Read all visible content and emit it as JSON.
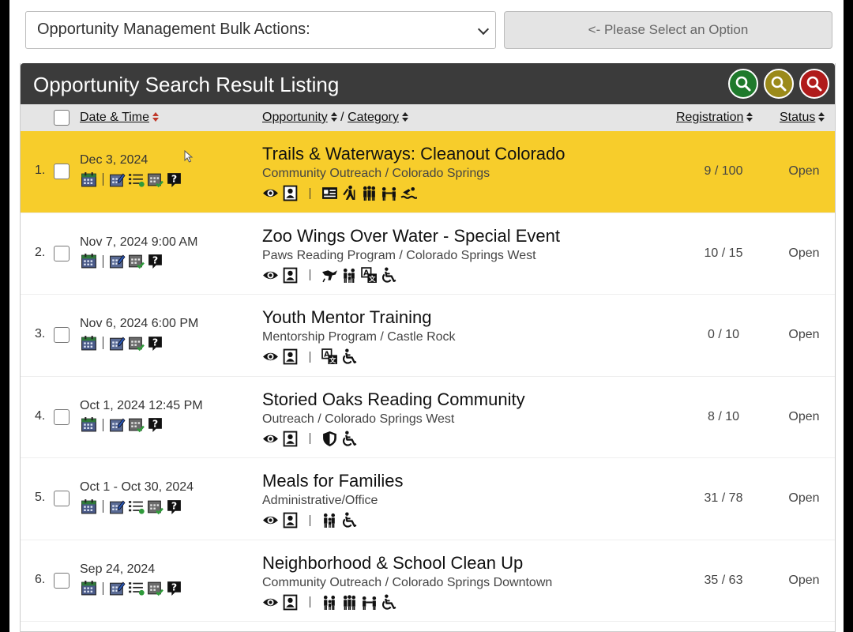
{
  "bulk": {
    "select_value": "Opportunity Management Bulk Actions:",
    "apply_label": "<- Please Select an Option"
  },
  "panel": {
    "title": "Opportunity Search Result Listing"
  },
  "columns": {
    "date": "Date & Time",
    "opportunity": "Opportunity",
    "slash": "/",
    "category": "Category",
    "registration": "Registration",
    "status": "Status"
  },
  "colors": {
    "highlight": "#f7cd2b",
    "header_bg": "#3b3b3b",
    "search_green": "#1f7a2c",
    "search_gold": "#9b8a1a",
    "search_red": "#b01b1b"
  },
  "rows": [
    {
      "num": "1.",
      "date": "Dec 3, 2024",
      "title": "Trails & Waterways: Cleanout Colorado",
      "subtitle": "Community Outreach / Colorado Springs",
      "registration": "9 / 100",
      "status": "Open",
      "highlighted": true,
      "action_icons": [
        "calendar-icon",
        "edit-calendar-icon",
        "checklist-icon",
        "calendar-check-icon",
        "help-icon"
      ],
      "badge_icons": [
        "id-card-icon",
        "hiking-icon",
        "group-icon",
        "team-icon",
        "swimming-icon"
      ]
    },
    {
      "num": "2.",
      "date": "Nov 7, 2024 9:00 AM",
      "title": "Zoo Wings Over Water - Special Event",
      "subtitle": "Paws Reading Program / Colorado Springs West",
      "registration": "10 / 15",
      "status": "Open",
      "highlighted": false,
      "action_icons": [
        "calendar-icon",
        "edit-calendar-icon",
        "calendar-check-icon",
        "help-icon"
      ],
      "badge_icons": [
        "animal-icon",
        "family-icon",
        "language-icon",
        "wheelchair-icon"
      ]
    },
    {
      "num": "3.",
      "date": "Nov 6, 2024 6:00 PM",
      "title": "Youth Mentor Training",
      "subtitle": "Mentorship Program / Castle Rock",
      "registration": "0 / 10",
      "status": "Open",
      "highlighted": false,
      "action_icons": [
        "calendar-icon",
        "edit-calendar-icon",
        "calendar-check-icon",
        "help-icon"
      ],
      "badge_icons": [
        "language-icon",
        "wheelchair-icon"
      ]
    },
    {
      "num": "4.",
      "date": "Oct 1, 2024 12:45 PM",
      "title": "Storied Oaks Reading Community",
      "subtitle": "Outreach / Colorado Springs West",
      "registration": "8 / 10",
      "status": "Open",
      "highlighted": false,
      "action_icons": [
        "calendar-icon",
        "edit-calendar-icon",
        "calendar-check-icon",
        "help-icon"
      ],
      "badge_icons": [
        "shield-icon",
        "wheelchair-icon"
      ]
    },
    {
      "num": "5.",
      "date": "Oct 1 - Oct 30, 2024",
      "title": "Meals for Families",
      "subtitle": "Administrative/Office",
      "registration": "31 / 78",
      "status": "Open",
      "highlighted": false,
      "action_icons": [
        "calendar-icon",
        "edit-calendar-icon",
        "checklist-icon",
        "calendar-check-icon",
        "help-icon"
      ],
      "badge_icons": [
        "family-icon",
        "wheelchair-icon"
      ]
    },
    {
      "num": "6.",
      "date": "Sep 24, 2024",
      "title": "Neighborhood & School Clean Up",
      "subtitle": "Community Outreach / Colorado Springs Downtown",
      "registration": "35 / 63",
      "status": "Open",
      "highlighted": false,
      "action_icons": [
        "calendar-icon",
        "edit-calendar-icon",
        "checklist-icon",
        "calendar-check-icon",
        "help-icon"
      ],
      "badge_icons": [
        "family-icon",
        "group-icon",
        "team-icon",
        "wheelchair-icon"
      ]
    }
  ]
}
